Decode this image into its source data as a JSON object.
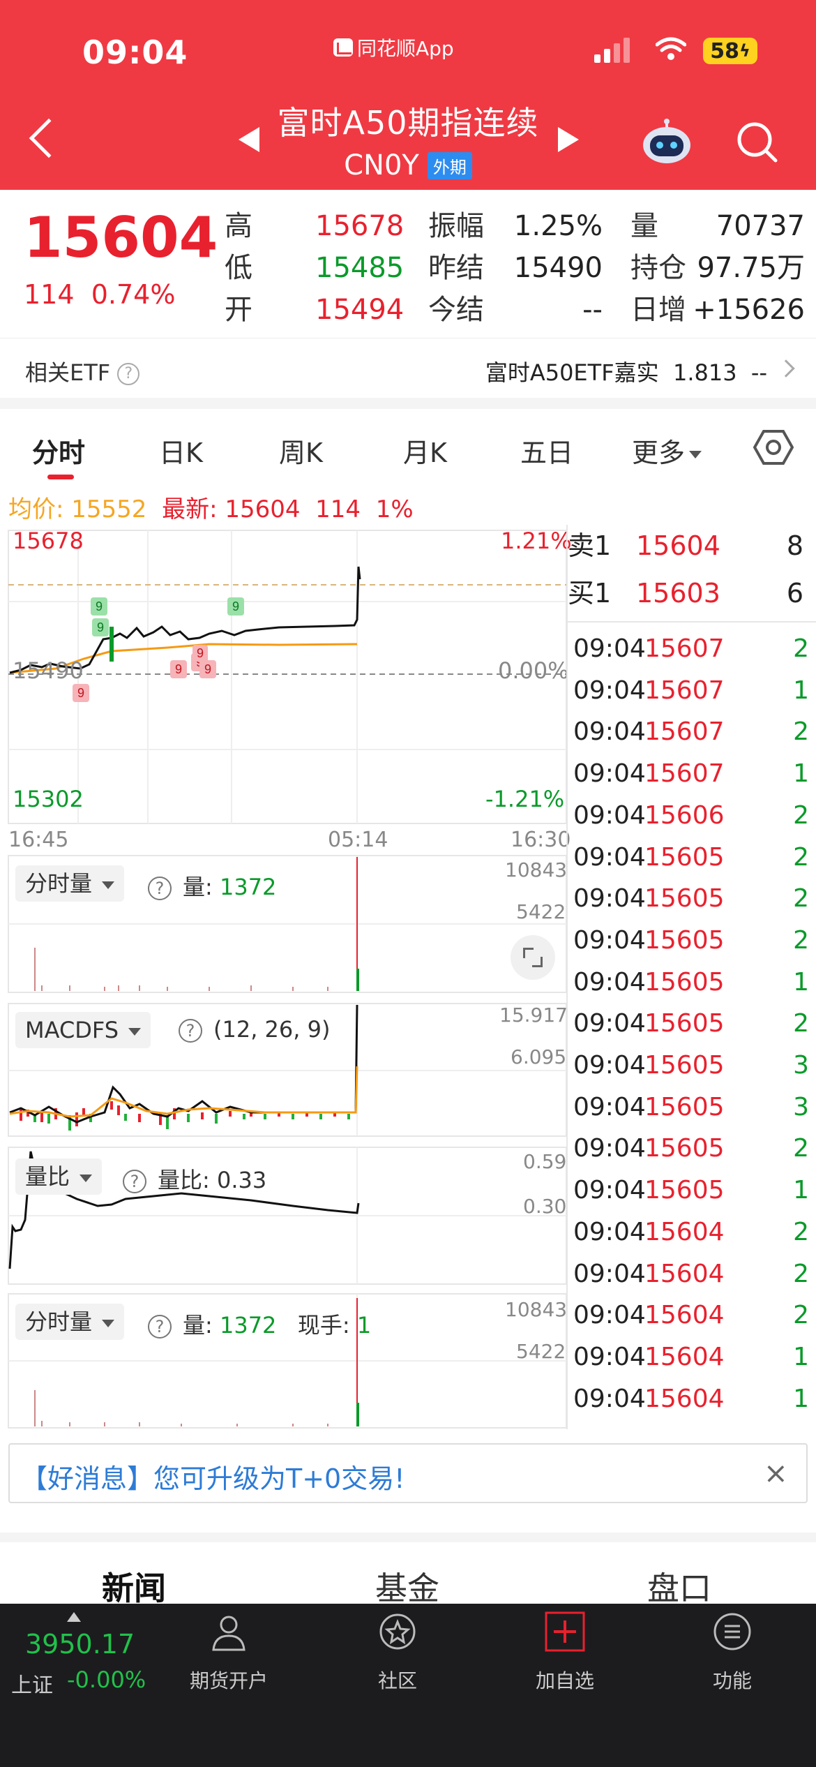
{
  "status": {
    "time": "09:04",
    "app": "同花顺App",
    "battery": "58"
  },
  "header": {
    "title": "富时A50期指连续",
    "code": "CN0Y",
    "tag": "外期"
  },
  "quote": {
    "price": "15604",
    "change": "114",
    "change_pct": "0.74%",
    "high_label": "高",
    "high": "15678",
    "low_label": "低",
    "low": "15485",
    "open_label": "开",
    "open": "15494",
    "amp_label": "振幅",
    "amp": "1.25%",
    "prev_label": "昨结",
    "prev": "15490",
    "today_label": "今结",
    "today": "--",
    "vol_label": "量",
    "vol": "70737",
    "oi_label": "持仓",
    "oi": "97.75万",
    "daily_label": "日增",
    "daily": "+15626"
  },
  "etf": {
    "label": "相关ETF",
    "name": "富时A50ETF嘉实",
    "value": "1.813",
    "change": "--"
  },
  "tabs": {
    "t1": "分时",
    "t2": "日K",
    "t3": "周K",
    "t4": "月K",
    "t5": "五日",
    "t6": "更多"
  },
  "avg": {
    "avg_label": "均价:",
    "avg": "15552",
    "new_label": "最新:",
    "new": "15604",
    "chg": "114",
    "pct": "1%"
  },
  "chart_data": [
    {
      "type": "line",
      "title": "",
      "x_ticks": [
        "16:45",
        "05:14",
        "16:30"
      ],
      "y_left_ticks": [
        "15678",
        "15490",
        "15302"
      ],
      "y_right_ticks": [
        "1.21%",
        "0.00%",
        "-1.21%"
      ],
      "ylim": [
        15302,
        15678
      ],
      "series": [
        {
          "name": "",
          "x": [
            0,
            0.1,
            0.2,
            0.3,
            0.45,
            0.6,
            0.8,
            0.98,
            1.0
          ],
          "y": [
            15492,
            15497,
            15515,
            15545,
            15540,
            15548,
            15552,
            15555,
            15604
          ]
        },
        {
          "name": "",
          "x": [
            0,
            0.2,
            0.3,
            0.5,
            0.8,
            1.0
          ],
          "y": [
            15490,
            15505,
            15525,
            15535,
            15538,
            15540
          ]
        }
      ],
      "annotations": [
        "9",
        "9",
        "9",
        "9",
        "9",
        "9",
        "9",
        "9"
      ]
    },
    {
      "type": "bar",
      "title": "分时量",
      "y_ticks": [
        "10843",
        "5422"
      ]
    },
    {
      "type": "line",
      "title": "MACDFS",
      "params": "(12, 26, 9)",
      "y_ticks": [
        "15.917",
        "6.095"
      ]
    },
    {
      "type": "line",
      "title": "量比",
      "y_ticks": [
        "0.59",
        "0.30"
      ]
    },
    {
      "type": "bar",
      "title": "分时量",
      "y_ticks": [
        "10843",
        "5422"
      ]
    }
  ],
  "panels": {
    "vol1_label": "分时量",
    "vol1_info_label": "量:",
    "vol1_info": "1372",
    "macd_label": "MACDFS",
    "macd_params": "(12, 26, 9)",
    "ratio_label": "量比",
    "ratio_info": "量比: 0.33",
    "vol2_label": "分时量",
    "vol2_info_label": "量:",
    "vol2_info": "1372",
    "vol2_hand_label": "现手:",
    "vol2_hand": "1"
  },
  "book": {
    "sell_label": "卖1",
    "sell_price": "15604",
    "sell_qty": "8",
    "buy_label": "买1",
    "buy_price": "15603",
    "buy_qty": "6",
    "ticks": [
      {
        "t": "09:04",
        "p": "15607",
        "q": "2"
      },
      {
        "t": "09:04",
        "p": "15607",
        "q": "1"
      },
      {
        "t": "09:04",
        "p": "15607",
        "q": "2"
      },
      {
        "t": "09:04",
        "p": "15607",
        "q": "1"
      },
      {
        "t": "09:04",
        "p": "15606",
        "q": "2"
      },
      {
        "t": "09:04",
        "p": "15605",
        "q": "2"
      },
      {
        "t": "09:04",
        "p": "15605",
        "q": "2"
      },
      {
        "t": "09:04",
        "p": "15605",
        "q": "2"
      },
      {
        "t": "09:04",
        "p": "15605",
        "q": "1"
      },
      {
        "t": "09:04",
        "p": "15605",
        "q": "2"
      },
      {
        "t": "09:04",
        "p": "15605",
        "q": "3"
      },
      {
        "t": "09:04",
        "p": "15605",
        "q": "3"
      },
      {
        "t": "09:04",
        "p": "15605",
        "q": "2"
      },
      {
        "t": "09:04",
        "p": "15605",
        "q": "1"
      },
      {
        "t": "09:04",
        "p": "15604",
        "q": "2"
      },
      {
        "t": "09:04",
        "p": "15604",
        "q": "2"
      },
      {
        "t": "09:04",
        "p": "15604",
        "q": "2"
      },
      {
        "t": "09:04",
        "p": "15604",
        "q": "1"
      },
      {
        "t": "09:04",
        "p": "15604",
        "q": "1"
      }
    ]
  },
  "promo": {
    "text": "【好消息】您可升级为T+0交易!",
    "close": "×"
  },
  "bottom_tabs": {
    "b1": "新闻",
    "b2": "基金",
    "b3": "盘口"
  },
  "footer": {
    "index_value": "3950.17",
    "index_name": "上证",
    "index_change": "-0.00%",
    "nav1": "期货开户",
    "nav2": "社区",
    "nav3": "加自选",
    "nav4": "功能"
  },
  "colors": {
    "header_bg": "#ef3a44",
    "up": "#e8212e",
    "down": "#0a9a2a",
    "avg": "#f5a623",
    "footer_bg": "#1c1c1e"
  }
}
